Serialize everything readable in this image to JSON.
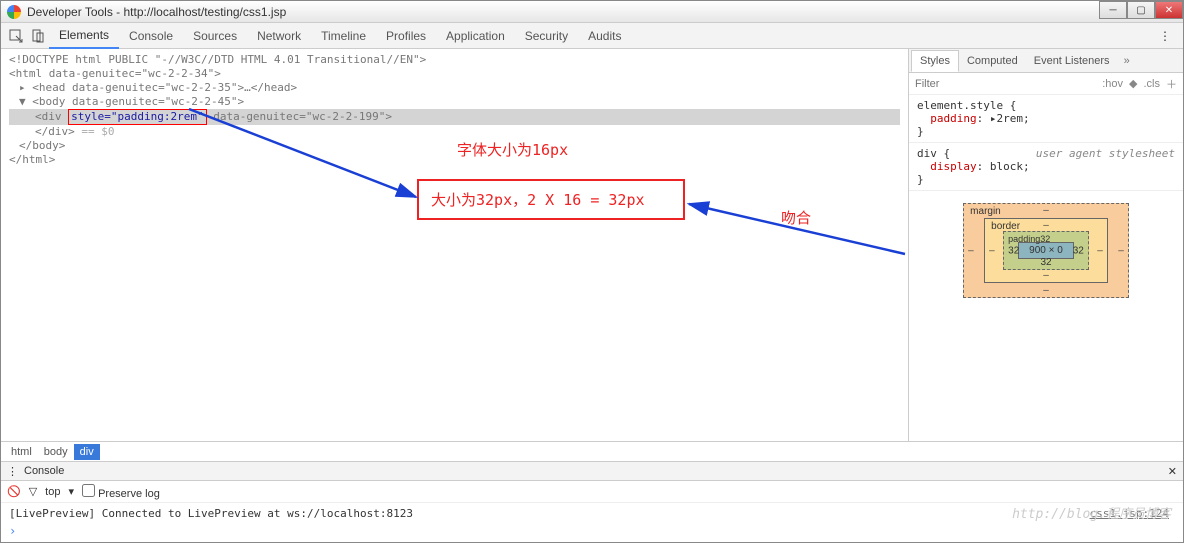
{
  "titlebar": {
    "title": "Developer Tools - http://localhost/testing/css1.jsp"
  },
  "tabs": [
    "Elements",
    "Console",
    "Sources",
    "Network",
    "Timeline",
    "Profiles",
    "Application",
    "Security",
    "Audits"
  ],
  "active_tab": "Elements",
  "dom": {
    "doctype": "<!DOCTYPE html PUBLIC \"-//W3C//DTD HTML 4.01 Transitional//EN\">",
    "html_open": "<html data-genuitec=\"wc-2-2-34\">",
    "head": "<head data-genuitec=\"wc-2-2-35\">…</head>",
    "body_open": "<body data-genuitec=\"wc-2-2-45\">",
    "div_open_pre": "<div ",
    "div_style": "style=\"padding:2rem\"",
    "div_open_post": " data-genuitec=\"wc-2-2-199\">",
    "div_close": "</div>",
    "size_note": " == $0",
    "body_close": "</body>",
    "html_close": "</html>"
  },
  "annotations": {
    "font_size": "字体大小为16px",
    "box_calc": "大小为32px，2 X 16 = 32px",
    "match": "吻合"
  },
  "side_tabs": [
    "Styles",
    "Computed",
    "Event Listeners"
  ],
  "filter": {
    "placeholder": "Filter",
    "hov": ":hov",
    "cls": ".cls"
  },
  "styles": {
    "rule1": {
      "selector": "element.style {",
      "prop": "padding",
      "val": "▸2rem;",
      "close": "}"
    },
    "rule2": {
      "selector": "div {",
      "prop": "display",
      "val": "block;",
      "close": "}",
      "sheet": "user agent stylesheet"
    }
  },
  "box_model": {
    "margin": "margin",
    "border": "border",
    "padding": "padding",
    "pad_val": "32",
    "content": "900 × 0"
  },
  "breadcrumb": [
    "html",
    "body",
    "div"
  ],
  "console": {
    "title": "Console",
    "top": "top",
    "preserve": "Preserve log",
    "msg": "[LivePreview] Connected to LivePreview at ws://localhost:8123",
    "loc": "css1.jsp:124"
  },
  "watermark": "http://blog.程序员博客"
}
